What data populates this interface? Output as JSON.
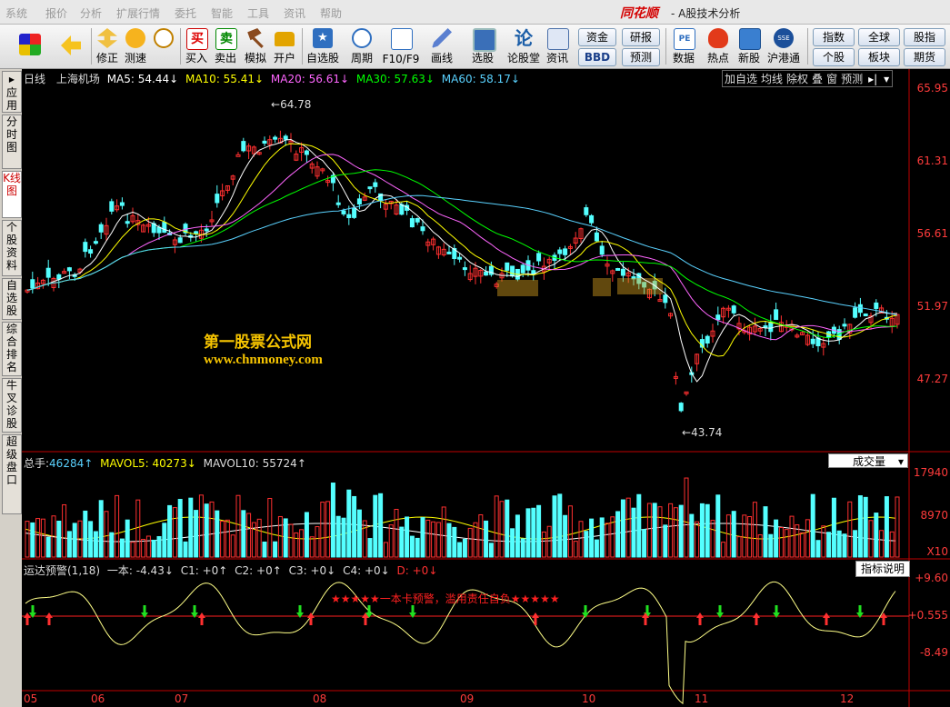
{
  "menu": [
    "系统",
    "报价",
    "分析",
    "扩展行情",
    "委托",
    "智能",
    "工具",
    "资讯",
    "帮助"
  ],
  "app": {
    "brand": "同花顺",
    "subtitle": "- A股技术分析"
  },
  "toolbar": {
    "buttons": [
      "修正",
      "测速",
      "买入",
      "卖出",
      "模拟",
      "开户",
      "自选股",
      "周期",
      "F10/F9",
      "画线",
      "选股",
      "论股堂",
      "资讯",
      "数据",
      "热点",
      "新股",
      "沪港通"
    ],
    "pills_mid": [
      "资金",
      "BBD",
      "研报",
      "预测"
    ],
    "pills_right": [
      "指数",
      "全球",
      "股指",
      "个股",
      "板块",
      "期货"
    ]
  },
  "sidebar": {
    "tabs": [
      "应用",
      "分时图",
      "K线图",
      "个股资料",
      "自选股",
      "综合排名",
      "牛叉诊股",
      "超级盘口"
    ]
  },
  "kline": {
    "period": "日线",
    "stock": "上海机场",
    "ma": [
      {
        "label": "MA5: 54.44↓",
        "color": "#ffffff"
      },
      {
        "label": "MA10: 55.41↓",
        "color": "#ffff00"
      },
      {
        "label": "MA20: 56.61↓",
        "color": "#ff66ff"
      },
      {
        "label": "MA30: 57.63↓",
        "color": "#00ff00"
      },
      {
        "label": "MA60: 58.17↓",
        "color": "#5ad2ff"
      }
    ],
    "buttons": [
      "加自选",
      "均线",
      "除权",
      "叠",
      "窗",
      "预测"
    ],
    "yticks": [
      "65.95",
      "61.31",
      "56.61",
      "51.97",
      "47.27"
    ],
    "high_label": "64.78",
    "low_label": "43.74",
    "watermark1": "第一股票公式网",
    "watermark2": "www.chnmoney.com"
  },
  "volume": {
    "label_total": "总手:",
    "total": "46284↑",
    "mavol5": "MAVOL5: 40273↓",
    "mavol10": "MAVOL10: 55724↑",
    "dropdown": "成交量",
    "yticks": [
      "17940",
      "8970"
    ],
    "unit": "X10"
  },
  "indicator": {
    "name": "运达预警(1,18)",
    "yiben": "一本: -4.43↓",
    "c1": "C1: +0↑",
    "c2": "C2: +0↑",
    "c3": "C3: +0↓",
    "c4": "C4: +0↓",
    "d": "D: +0↓",
    "button": "指标说明",
    "warning": "★★★★★一本卡预警，滥用责任自负★★★★★",
    "yticks": [
      "+9.60",
      "+0.555",
      "-8.49"
    ]
  },
  "xaxis": [
    "05",
    "06",
    "07",
    "08",
    "09",
    "10",
    "11",
    "12"
  ],
  "colors": {
    "up": "#ff3030",
    "down": "#54ffff",
    "axis": "#c00000"
  }
}
